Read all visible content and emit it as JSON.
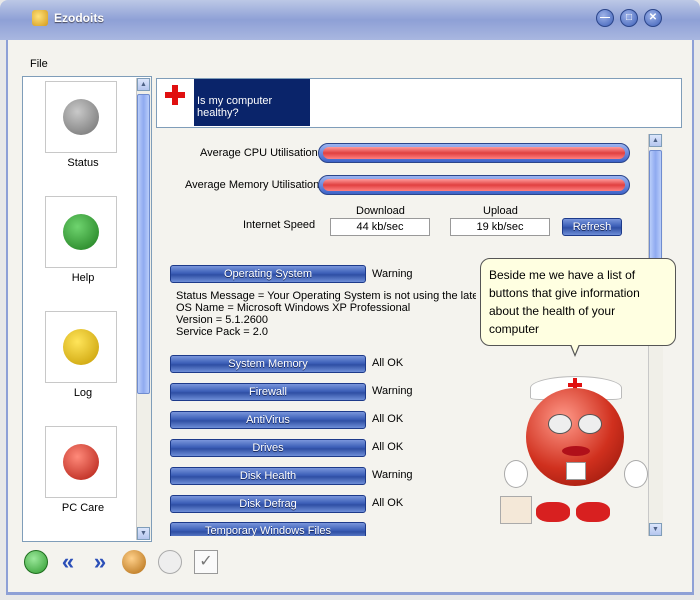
{
  "window": {
    "title": "Ezodoits"
  },
  "menu": {
    "file": "File"
  },
  "sidebar": {
    "items": [
      {
        "label": "Status",
        "icon": "gray-character-icon"
      },
      {
        "label": "Help",
        "icon": "green-character-icon"
      },
      {
        "label": "Log",
        "icon": "yellow-character-icon"
      },
      {
        "label": "PC Care",
        "icon": "red-nurse-character-icon"
      }
    ]
  },
  "header": {
    "question": "Is my computer healthy?"
  },
  "metrics": {
    "cpu_label": "Average CPU Utilisation",
    "cpu_fraction": 1.0,
    "memory_label": "Average Memory Utilisation",
    "memory_fraction": 1.0,
    "internet_label": "Internet Speed",
    "download_label": "Download",
    "download_value": "44 kb/sec",
    "upload_label": "Upload",
    "upload_value": "19 kb/sec",
    "refresh_label": "Refresh"
  },
  "checks": [
    {
      "label": "Operating System",
      "status": "Warning"
    },
    {
      "label": "System Memory",
      "status": "All OK"
    },
    {
      "label": "Firewall",
      "status": "Warning"
    },
    {
      "label": "AntiVirus",
      "status": "All OK"
    },
    {
      "label": "Drives",
      "status": "All OK"
    },
    {
      "label": "Disk Health",
      "status": "Warning"
    },
    {
      "label": "Disk Defrag",
      "status": "All OK"
    },
    {
      "label": "Temporary Windows Files",
      "status": ""
    }
  ],
  "os_info": {
    "line1": "Status Message = Your Operating System is not using the latest s",
    "line2": "OS Name = Microsoft Windows XP Professional",
    "line3": "Version = 5.1.2600",
    "line4": "Service Pack = 2.0"
  },
  "bubble": {
    "text": "Beside me we have a list of buttons that give information about the health of your computer"
  },
  "toolbar": {
    "icons": [
      "speaker-icon",
      "back-icon",
      "forward-icon",
      "agent-icon",
      "speech-icon",
      "checklist-icon"
    ]
  },
  "colors": {
    "accent": "#3c5fb8",
    "warning_bar": "#e04040",
    "selection": "#0a246a"
  }
}
